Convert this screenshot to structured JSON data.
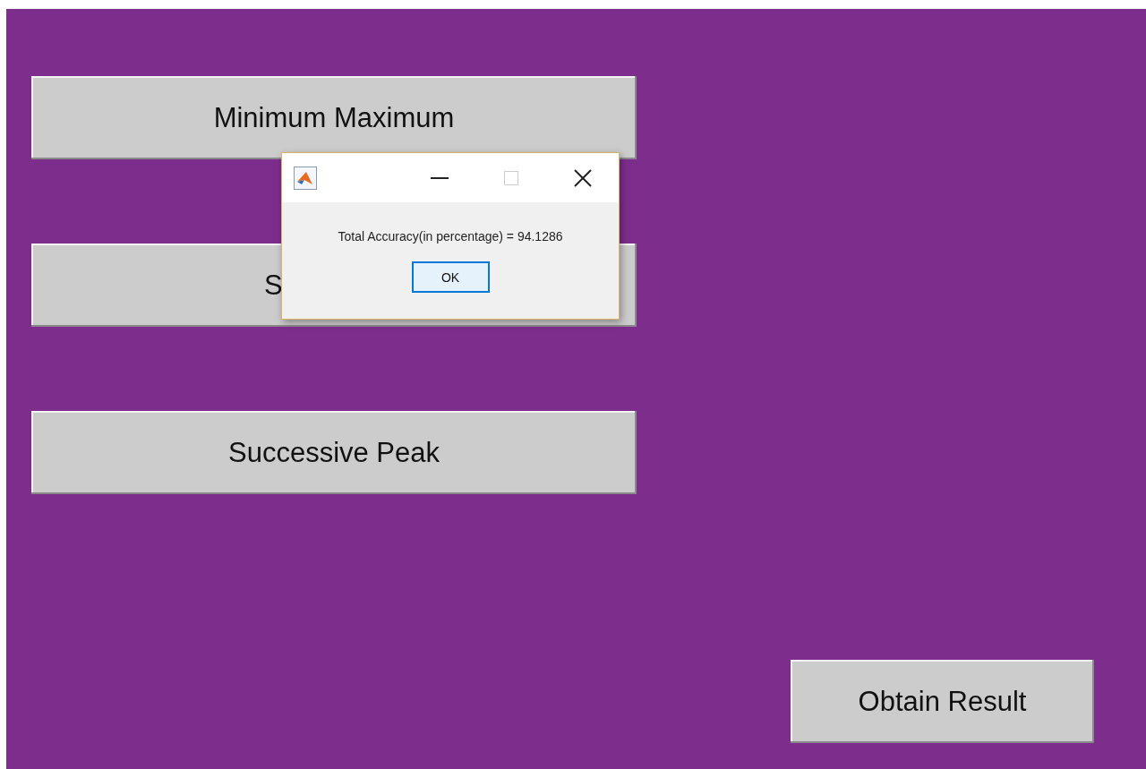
{
  "buttons": [
    {
      "label": "Minimum Maximum"
    },
    {
      "label": "S",
      "kind": "covered"
    },
    {
      "label": "Successive Peak"
    }
  ],
  "action_button": {
    "label": "Obtain Result"
  },
  "dialog": {
    "message": "Total Accuracy(in percentage) = 94.1286",
    "button": "OK"
  }
}
